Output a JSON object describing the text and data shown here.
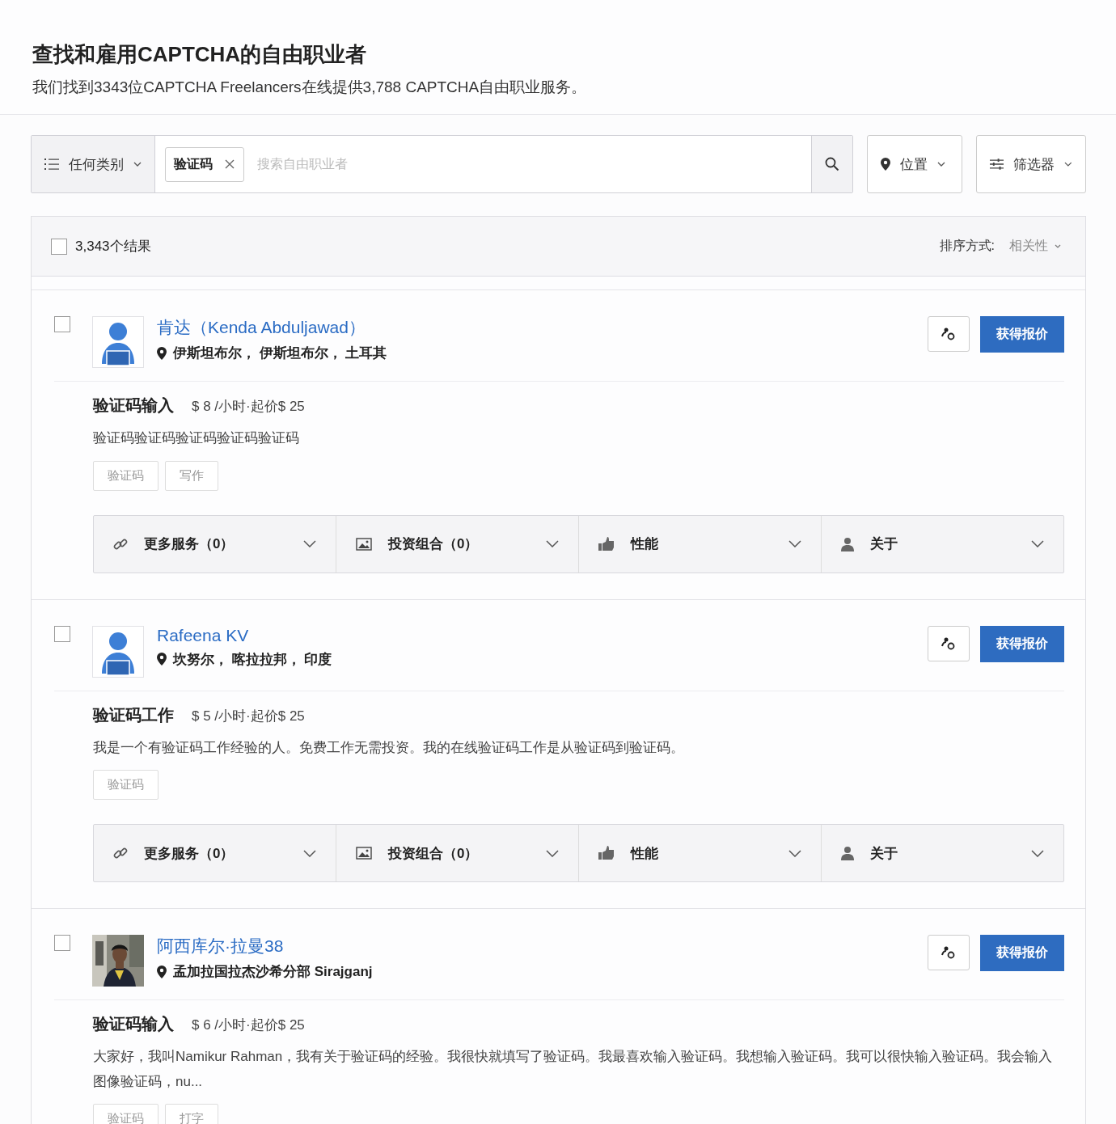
{
  "header": {
    "title": "查找和雇用CAPTCHA的自由职业者",
    "subtitle": "我们找到3343位CAPTCHA Freelancers在线提供3,788 CAPTCHA自由职业服务。"
  },
  "search": {
    "category": "任何类别",
    "chip": "验证码",
    "placeholder": "搜索自由职业者",
    "location": "位置",
    "filters": "筛选器"
  },
  "results": {
    "checked": false,
    "count": "3,343个结果",
    "sort_label": "排序方式:",
    "sort_value": "相关性"
  },
  "freelancers": [
    {
      "checked": false,
      "kind": "default",
      "name": "肯达（Kenda Abduljawad）",
      "location": "伊斯坦布尔， 伊斯坦布尔， 土耳其",
      "quote": "获得报价",
      "gig_title": "验证码输入",
      "rate": "$ 8 /小时·起价$ 25",
      "description": "验证码验证码验证码验证码验证码",
      "tags": [
        "验证码",
        "写作"
      ],
      "sections": [
        {
          "kind": "services",
          "label": "更多服务（0）"
        },
        {
          "kind": "portfolio",
          "label": "投资组合（0）"
        },
        {
          "kind": "performance",
          "label": "性能"
        },
        {
          "kind": "about",
          "label": "关于"
        }
      ]
    },
    {
      "checked": false,
      "kind": "default",
      "name": "Rafeena KV",
      "location": "坎努尔， 喀拉拉邦， 印度",
      "quote": "获得报价",
      "gig_title": "验证码工作",
      "rate": "$ 5 /小时·起价$ 25",
      "description": "我是一个有验证码工作经验的人。免费工作无需投资。我的在线验证码工作是从验证码到验证码。",
      "tags": [
        "验证码"
      ],
      "sections": [
        {
          "kind": "services",
          "label": "更多服务（0）"
        },
        {
          "kind": "portfolio",
          "label": "投资组合（0）"
        },
        {
          "kind": "performance",
          "label": "性能"
        },
        {
          "kind": "about",
          "label": "关于"
        }
      ]
    },
    {
      "checked": false,
      "kind": "picture",
      "name": "阿西库尔·拉曼38",
      "location": "孟加拉国拉杰沙希分部 Sirajganj",
      "quote": "获得报价",
      "gig_title": "验证码输入",
      "rate": "$ 6 /小时·起价$ 25",
      "description": "大家好，我叫Namikur Rahman，我有关于验证码的经验。我很快就填写了验证码。我最喜欢输入验证码。我想输入验证码。我可以很快输入验证码。我会输入图像验证码，nu...",
      "tags": [
        "验证码",
        "打字"
      ]
    }
  ]
}
